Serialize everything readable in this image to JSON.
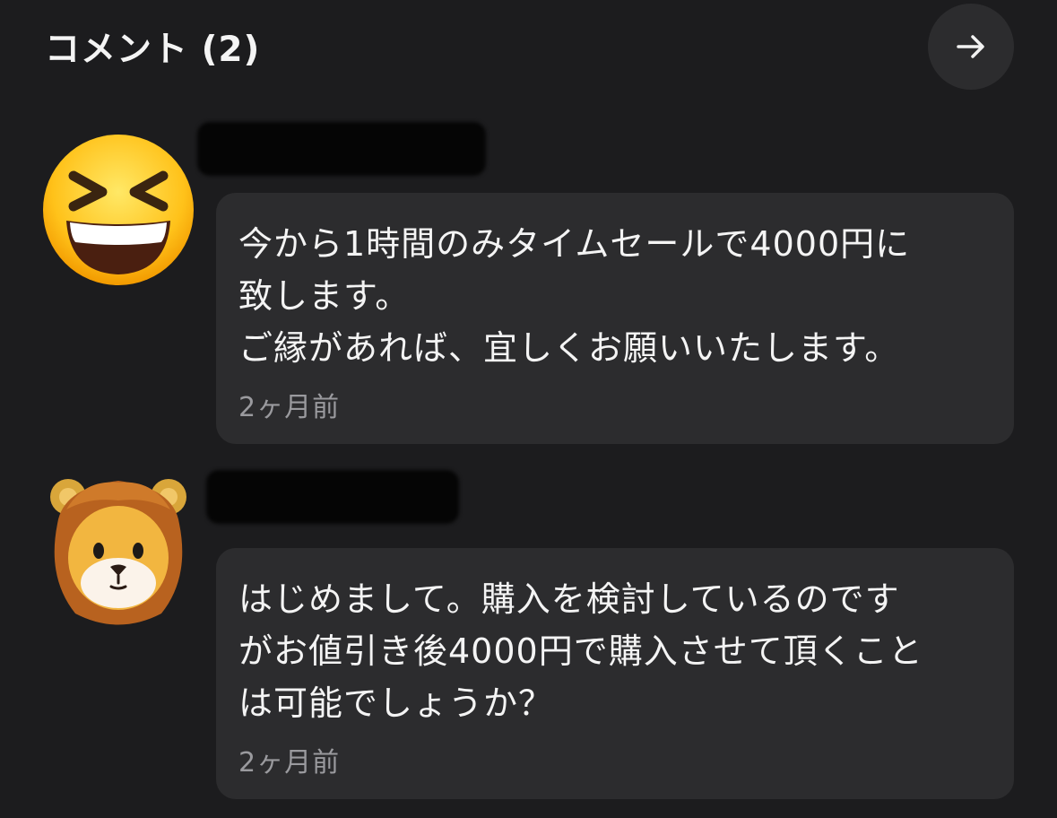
{
  "header": {
    "title": "コメント (2)",
    "arrow_icon": "arrow-right-icon"
  },
  "comments": [
    {
      "avatar_icon": "grinning-squinting-face-emoji",
      "username_redacted": true,
      "text": "今から1時間のみタイムセールで4000円に\n致します。\nご縁があれば、宜しくお願いいたします。",
      "time": "2ヶ月前"
    },
    {
      "avatar_icon": "lion-memoji",
      "username_redacted": true,
      "text": "はじめまして。購入を検討しているのです\nがお値引き後4000円で購入させて頂くこと\nは可能でしょうか？",
      "time": "2ヶ月前"
    }
  ],
  "colors": {
    "background": "#1c1c1e",
    "bubble": "#2c2c2e",
    "text": "#f4f4f4",
    "secondary_text": "#9a9a9e"
  }
}
